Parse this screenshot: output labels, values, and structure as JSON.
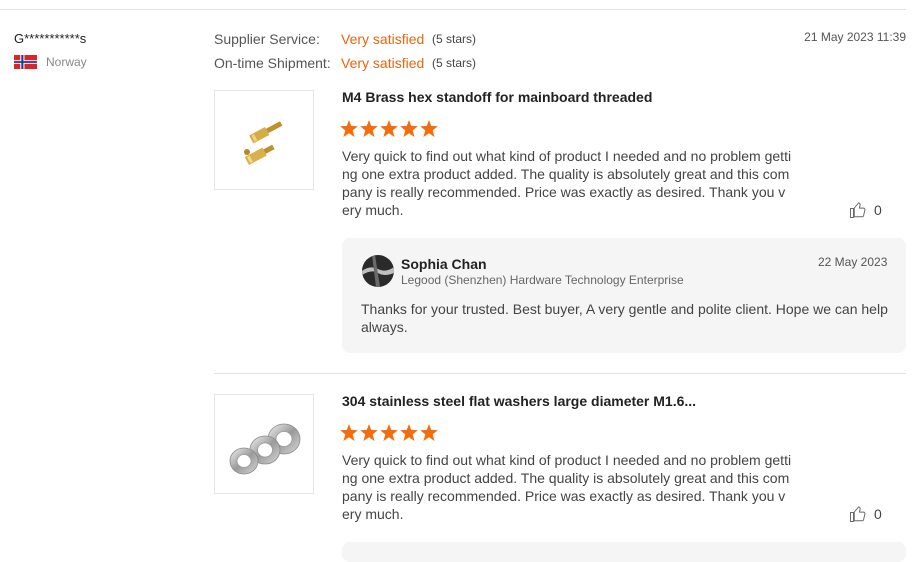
{
  "buyer": {
    "name": "G***********s",
    "country": "Norway",
    "flag": "norway-flag"
  },
  "ratings": [
    {
      "label": "Supplier Service:",
      "value": "Very satisfied",
      "stars": "(5 stars)"
    },
    {
      "label": "On-time Shipment:",
      "value": "Very satisfied",
      "stars": "(5 stars)"
    }
  ],
  "review_date": "21 May 2023 11:39",
  "items": [
    {
      "title": "M4 Brass hex standoff for mainboard threaded",
      "rating": 5,
      "text": "Very quick to find out what kind of product I needed and no problem getting one extra product added. The quality is absolutely great and this company is really recommended. Price was exactly as desired. Thank you very much.",
      "likes": "0",
      "image": "brass-standoff-image"
    },
    {
      "title": "304 stainless steel flat washers large diameter M1.6...",
      "rating": 5,
      "text": "Very quick to find out what kind of product I needed and no problem getting one extra product added. The quality is absolutely great and this company is really recommended. Price was exactly as desired. Thank you very much.",
      "likes": "0",
      "image": "steel-washers-image"
    }
  ],
  "reply": {
    "name": "Sophia Chan",
    "company": "Legood (Shenzhen) Hardware Technology Enterprise",
    "date": "22 May 2023",
    "text": "Thanks for your trusted. Best buyer, A very gentle and polite client. Hope we can help always."
  },
  "colors": {
    "accent": "#e8650f",
    "star": "#f36d0f",
    "reply_bg": "#f5f5f5"
  }
}
